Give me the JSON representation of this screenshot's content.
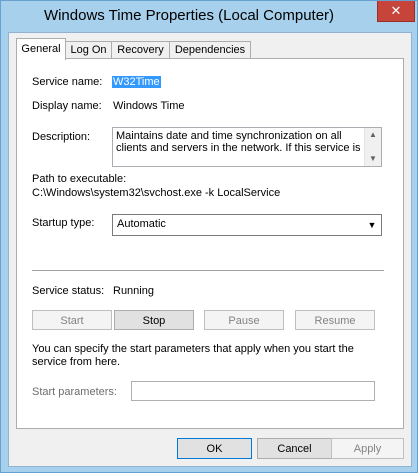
{
  "window": {
    "title": "Windows Time Properties (Local Computer)",
    "close_glyph": "✕"
  },
  "tabs": [
    {
      "label": "General",
      "active": true
    },
    {
      "label": "Log On",
      "active": false
    },
    {
      "label": "Recovery",
      "active": false
    },
    {
      "label": "Dependencies",
      "active": false
    }
  ],
  "general": {
    "service_name_label": "Service name:",
    "service_name_value": "W32Time",
    "display_name_label": "Display name:",
    "display_name_value": "Windows Time",
    "description_label": "Description:",
    "description_value": "Maintains date and time synchronization on all clients and servers in the network. If this service is",
    "path_label": "Path to executable:",
    "path_value": "C:\\Windows\\system32\\svchost.exe -k LocalService",
    "startup_type_label": "Startup type:",
    "startup_type_value": "Automatic",
    "service_status_label": "Service status:",
    "service_status_value": "Running",
    "start_label": "Start",
    "stop_label": "Stop",
    "pause_label": "Pause",
    "resume_label": "Resume",
    "hint_text": "You can specify the start parameters that apply when you start the service from here.",
    "start_params_label": "Start parameters:",
    "start_params_value": ""
  },
  "footer": {
    "ok_label": "OK",
    "cancel_label": "Cancel",
    "apply_label": "Apply"
  },
  "colors": {
    "title_bar": "#a7d0ec",
    "close_button": "#c7443a",
    "selection": "#3399ff"
  },
  "icons": {
    "close": "close-icon",
    "scroll_up": "scroll-up-icon",
    "scroll_down": "scroll-down-icon",
    "dropdown": "chevron-down-icon"
  }
}
